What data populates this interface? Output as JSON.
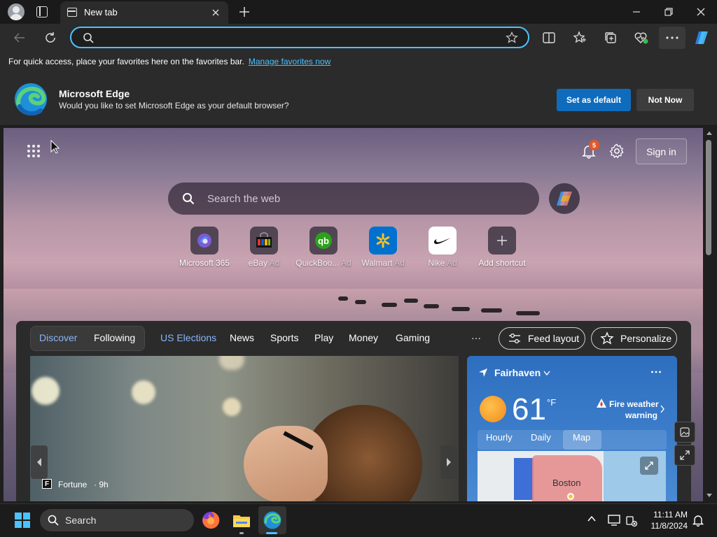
{
  "browser": {
    "tab_title": "New tab",
    "address_value": "",
    "favorites_bar": {
      "text": "For quick access, place your favorites here on the favorites bar.",
      "link": "Manage favorites now"
    }
  },
  "default_banner": {
    "title": "Microsoft Edge",
    "message": "Would you like to set Microsoft Edge as your default browser?",
    "set_default": "Set as default",
    "not_now": "Not Now"
  },
  "new_tab": {
    "notification_count": "5",
    "sign_in": "Sign in",
    "search_placeholder": "Search the web",
    "shortcuts": [
      {
        "label": "Microsoft 365",
        "ad": ""
      },
      {
        "label": "eBay",
        "ad": "Ad"
      },
      {
        "label": "QuickBoo...",
        "ad": "Ad"
      },
      {
        "label": "Walmart",
        "ad": "Ad"
      },
      {
        "label": "Nike",
        "ad": "Ad"
      },
      {
        "label": "Add shortcut",
        "ad": ""
      }
    ]
  },
  "feed": {
    "tabs": {
      "discover": "Discover",
      "following": "Following",
      "us_elections": "US Elections",
      "news": "News",
      "sports": "Sports",
      "play": "Play",
      "money": "Money",
      "gaming": "Gaming"
    },
    "more": "···",
    "feed_layout": "Feed layout",
    "personalize": "Personalize",
    "hero": {
      "source": "Fortune",
      "age": "· 9h"
    }
  },
  "weather": {
    "location": "Fairhaven",
    "temperature": "61",
    "unit": "°F",
    "alert_line1": "Fire weather",
    "alert_line2": "warning",
    "tabs": {
      "hourly": "Hourly",
      "daily": "Daily",
      "map": "Map"
    },
    "map_label": "Boston"
  },
  "taskbar": {
    "search_placeholder": "Search",
    "time": "11:11 AM",
    "date": "11/8/2024"
  },
  "colors": {
    "accent": "#4cc2ff",
    "primary_button": "#0f6cbd",
    "weather_card": "#3d7fcc"
  }
}
